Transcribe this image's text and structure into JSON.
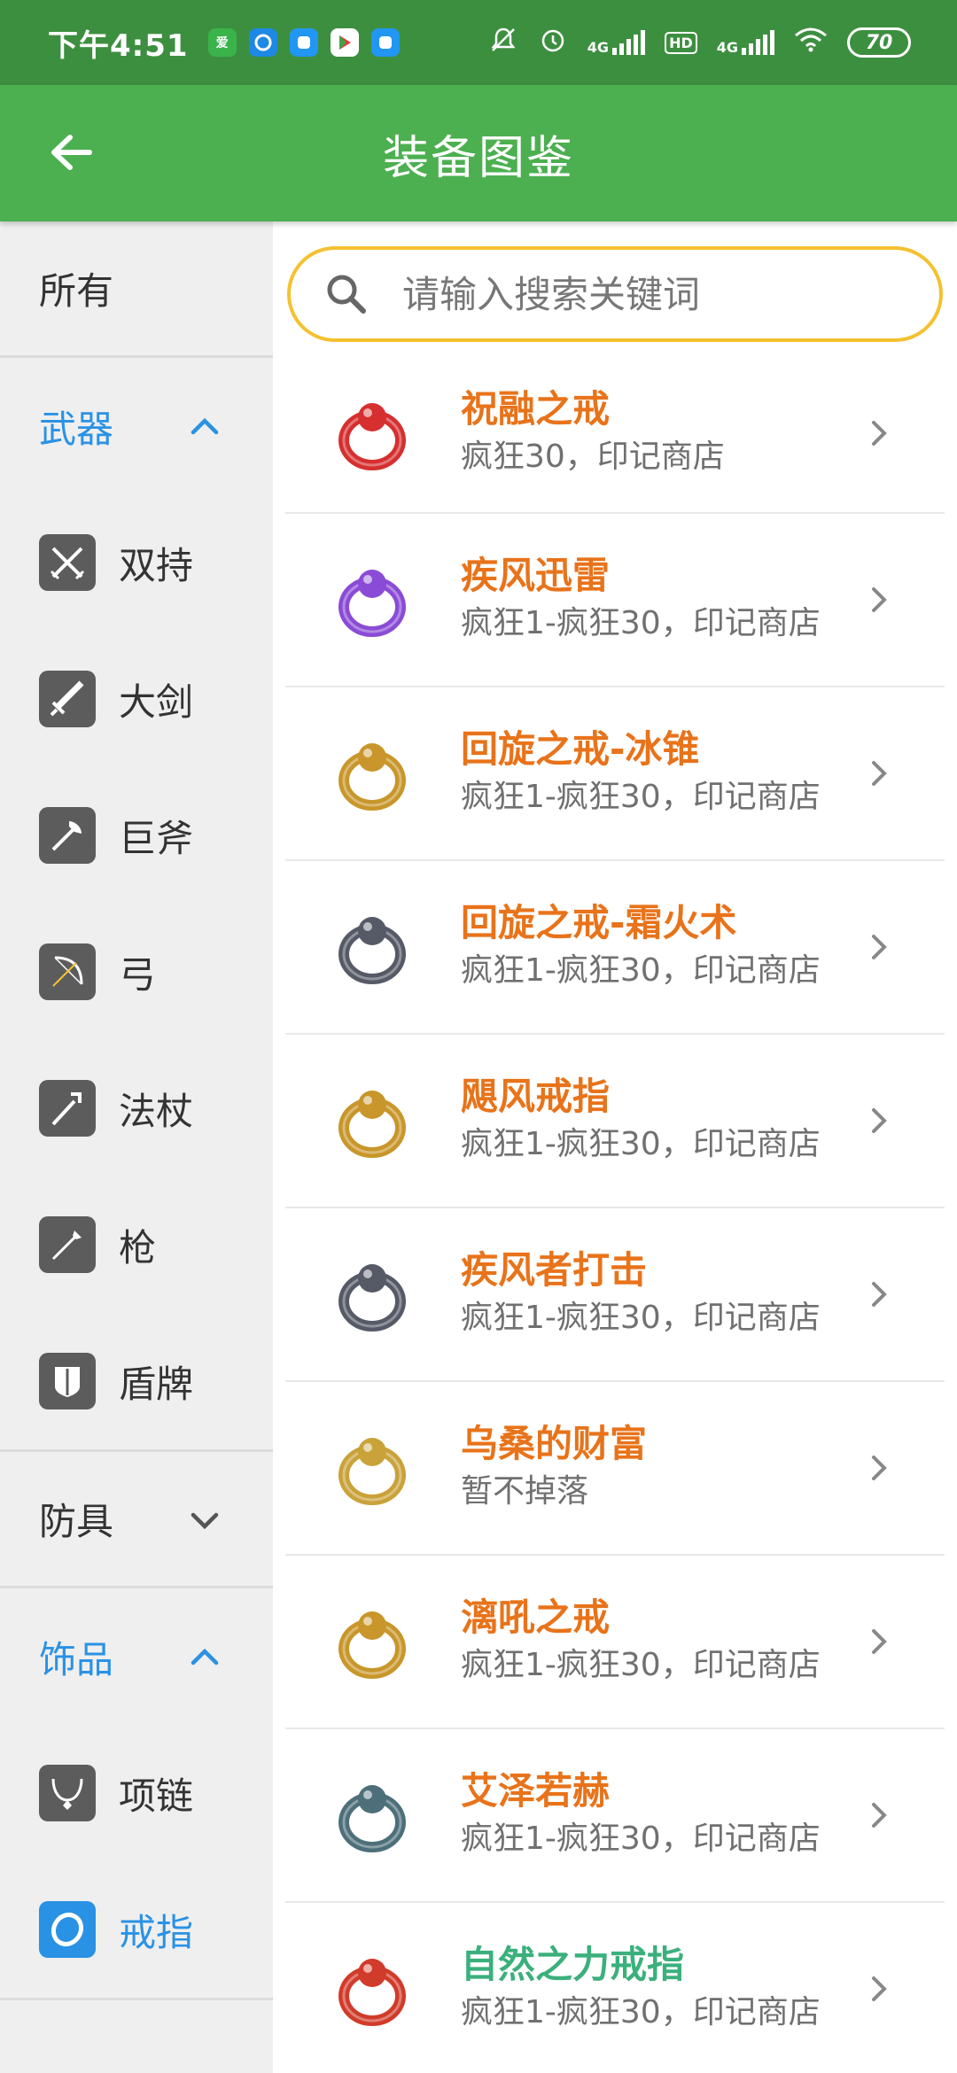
{
  "status_bar": {
    "time": "下午4:51",
    "network_1": "4G",
    "hd": "HD",
    "network_2": "4G",
    "battery": "70"
  },
  "app_bar": {
    "title": "装备图鉴"
  },
  "search": {
    "placeholder": "请输入搜索关键词"
  },
  "sidebar": {
    "all": "所有",
    "weapons": {
      "label": "武器",
      "items": [
        "双持",
        "大剑",
        "巨斧",
        "弓",
        "法杖",
        "枪",
        "盾牌"
      ]
    },
    "armor": {
      "label": "防具"
    },
    "accessories": {
      "label": "饰品",
      "items": [
        "项链",
        "戒指"
      ]
    }
  },
  "items": [
    {
      "name": "祝融之戒",
      "source": "疯狂30，印记商店",
      "color": "#e8731a",
      "ring_color": "#d62f2f"
    },
    {
      "name": "疾风迅雷",
      "source": "疯狂1-疯狂30，印记商店",
      "color": "#e8731a",
      "ring_color": "#8a4bd6"
    },
    {
      "name": "回旋之戒-冰锥",
      "source": "疯狂1-疯狂30，印记商店",
      "color": "#e8731a",
      "ring_color": "#c8962a"
    },
    {
      "name": "回旋之戒-霜火术",
      "source": "疯狂1-疯狂30，印记商店",
      "color": "#e8731a",
      "ring_color": "#555a66"
    },
    {
      "name": "飓风戒指",
      "source": "疯狂1-疯狂30，印记商店",
      "color": "#e8731a",
      "ring_color": "#c8962a"
    },
    {
      "name": "疾风者打击",
      "source": "疯狂1-疯狂30，印记商店",
      "color": "#e8731a",
      "ring_color": "#555a66"
    },
    {
      "name": "乌桑的财富",
      "source": "暂不掉落",
      "color": "#e8731a",
      "ring_color": "#c9a23a"
    },
    {
      "name": "漓吼之戒",
      "source": "疯狂1-疯狂30，印记商店",
      "color": "#e8731a",
      "ring_color": "#c8962a"
    },
    {
      "name": "艾泽若赫",
      "source": "疯狂1-疯狂30，印记商店",
      "color": "#e8731a",
      "ring_color": "#4d6f7a"
    },
    {
      "name": "自然之力戒指",
      "source": "疯狂1-疯狂30，印记商店",
      "color": "#3bb07c",
      "ring_color": "#d13b2a"
    }
  ],
  "colors": {
    "status_bar": "#3d8f40",
    "app_bar": "#4caf50",
    "accent_blue": "#2a92e4",
    "search_border": "#f4c12f"
  }
}
